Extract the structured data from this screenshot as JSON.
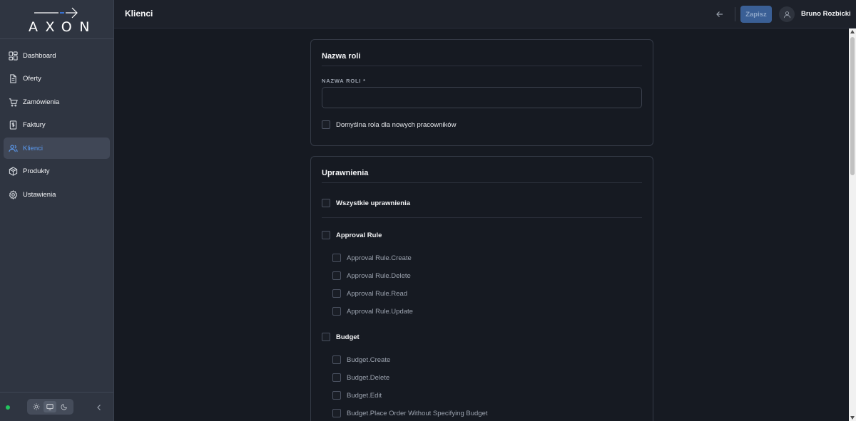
{
  "app": {
    "logo_text": "AXON"
  },
  "sidebar": {
    "items": [
      {
        "label": "Dashboard",
        "icon": "dashboard-icon"
      },
      {
        "label": "Oferty",
        "icon": "document-icon"
      },
      {
        "label": "Zamówienia",
        "icon": "cart-icon"
      },
      {
        "label": "Faktury",
        "icon": "invoice-icon"
      },
      {
        "label": "Klienci",
        "icon": "users-icon",
        "active": true
      },
      {
        "label": "Produkty",
        "icon": "package-icon"
      },
      {
        "label": "Ustawienia",
        "icon": "gear-icon"
      }
    ],
    "theme_options": [
      "sun-icon",
      "monitor-icon",
      "moon-icon"
    ],
    "selected_theme": "monitor-icon"
  },
  "header": {
    "title": "Klienci",
    "save_label": "Zapisz",
    "user_name": "Bruno Rozbicki"
  },
  "role_card": {
    "title": "Nazwa roli",
    "field_label": "NAZWA ROLI *",
    "field_value": "",
    "default_checkbox_label": "Domyślna rola dla nowych pracowników"
  },
  "permissions_card": {
    "title": "Uprawnienia",
    "all_label": "Wszystkie uprawnienia",
    "groups": [
      {
        "name": "Approval Rule",
        "items": [
          "Approval Rule.Create",
          "Approval Rule.Delete",
          "Approval Rule.Read",
          "Approval Rule.Update"
        ]
      },
      {
        "name": "Budget",
        "items": [
          "Budget.Create",
          "Budget.Delete",
          "Budget.Edit",
          "Budget.Place Order Without Specifying Budget"
        ]
      }
    ]
  },
  "colors": {
    "sidebar_bg": "#2f3541",
    "active_item_text": "#5b9bf1",
    "save_button_bg": "#3a5f95",
    "status_online": "#22c55e"
  }
}
